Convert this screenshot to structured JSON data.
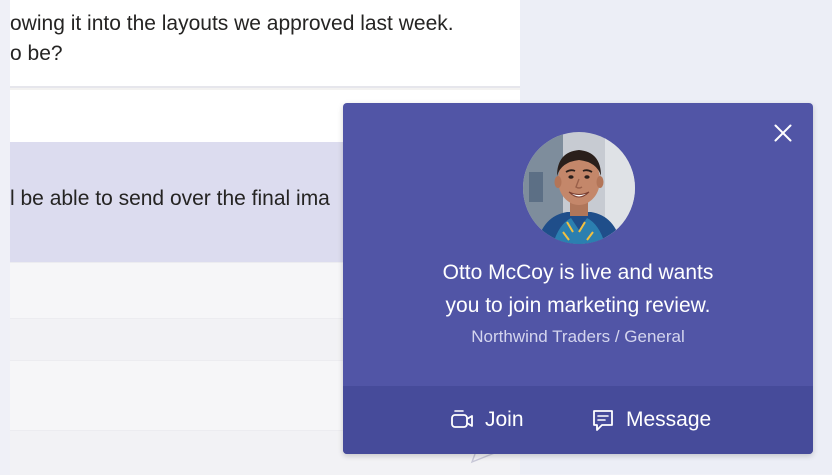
{
  "chat": {
    "message_line_1": "owing it into the layouts we approved last week.",
    "message_line_2": "o be?",
    "highlight_text": "l be able to send over the final ima"
  },
  "notification": {
    "title_line_1": "Otto McCoy is live and wants",
    "title_line_2": "you to join marketing review.",
    "subtitle": "Northwind Traders / General",
    "close_icon": "close-icon",
    "avatar_alt": "Otto McCoy",
    "actions": {
      "join_label": "Join",
      "join_icon": "video-camera-icon",
      "message_label": "Message",
      "message_icon": "chat-bubble-icon"
    }
  },
  "colors": {
    "toast_bg": "#5155a6",
    "toast_action_bar": "#464b9a",
    "highlight_row": "#dcdcef"
  }
}
